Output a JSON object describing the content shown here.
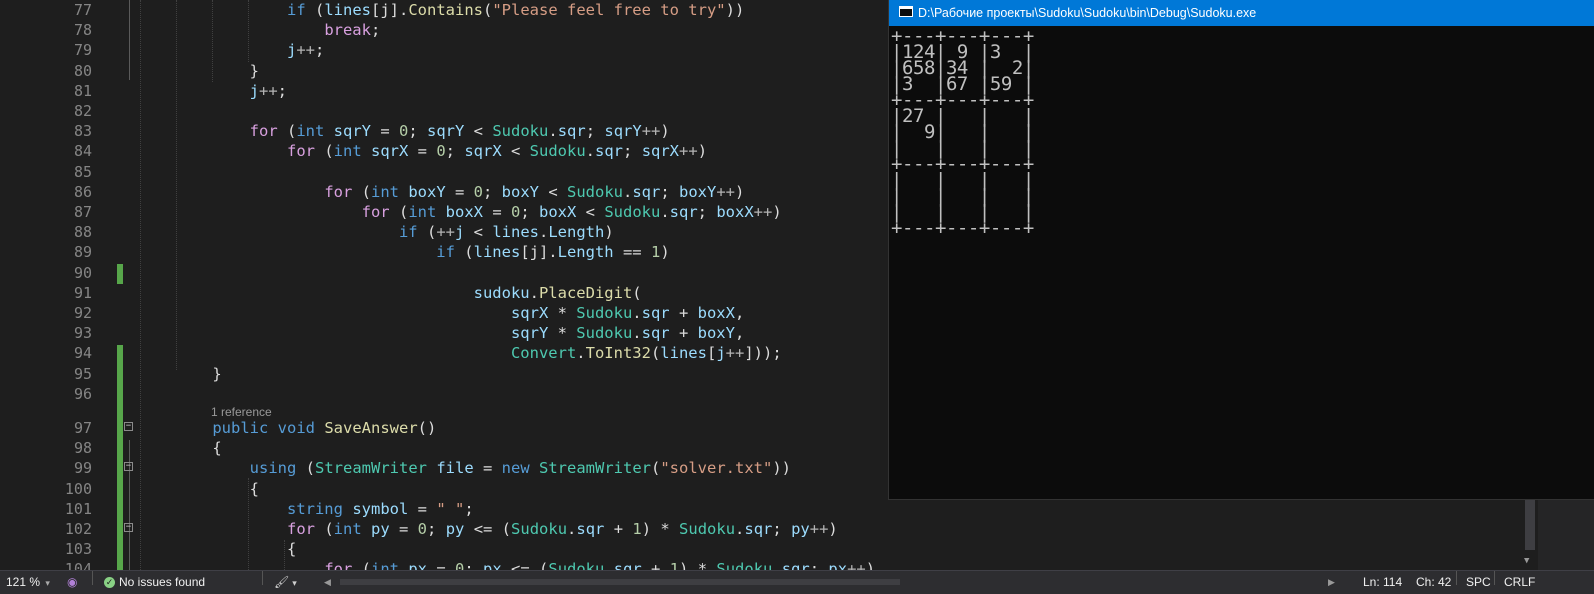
{
  "editor": {
    "reference_hint": "1 reference",
    "lines": [
      {
        "no": "77",
        "tokens": [
          [
            "p",
            "            "
          ],
          [
            "k",
            "if"
          ],
          [
            "p",
            " ("
          ],
          [
            "v",
            "lines"
          ],
          [
            "p",
            "[j]."
          ],
          [
            "m",
            "Contains"
          ],
          [
            "p",
            "("
          ],
          [
            "s",
            "\"Please feel free to try\""
          ],
          [
            "p",
            "))"
          ]
        ]
      },
      {
        "no": "78",
        "tokens": [
          [
            "p",
            "                "
          ],
          [
            "c",
            "break"
          ],
          [
            "p",
            ";"
          ]
        ]
      },
      {
        "no": "79",
        "tokens": [
          [
            "p",
            "            "
          ],
          [
            "v",
            "j"
          ],
          [
            "o",
            "++"
          ],
          [
            "p",
            ";"
          ]
        ]
      },
      {
        "no": "80",
        "tokens": [
          [
            "p",
            "        }"
          ]
        ]
      },
      {
        "no": "81",
        "tokens": [
          [
            "p",
            "        "
          ],
          [
            "v",
            "j"
          ],
          [
            "o",
            "++"
          ],
          [
            "p",
            ";"
          ]
        ]
      },
      {
        "no": "82",
        "tokens": []
      },
      {
        "no": "83",
        "tokens": [
          [
            "p",
            "        "
          ],
          [
            "c",
            "for"
          ],
          [
            "p",
            " ("
          ],
          [
            "k",
            "int"
          ],
          [
            "p",
            " "
          ],
          [
            "v",
            "sqrY"
          ],
          [
            "p",
            " = "
          ],
          [
            "n",
            "0"
          ],
          [
            "p",
            "; "
          ],
          [
            "v",
            "sqrY"
          ],
          [
            "p",
            " < "
          ],
          [
            "t",
            "Sudoku"
          ],
          [
            "p",
            "."
          ],
          [
            "v",
            "sqr"
          ],
          [
            "p",
            "; "
          ],
          [
            "v",
            "sqrY"
          ],
          [
            "o",
            "++"
          ],
          [
            "p",
            ")"
          ]
        ]
      },
      {
        "no": "84",
        "tokens": [
          [
            "p",
            "            "
          ],
          [
            "c",
            "for"
          ],
          [
            "p",
            " ("
          ],
          [
            "k",
            "int"
          ],
          [
            "p",
            " "
          ],
          [
            "v",
            "sqrX"
          ],
          [
            "p",
            " = "
          ],
          [
            "n",
            "0"
          ],
          [
            "p",
            "; "
          ],
          [
            "v",
            "sqrX"
          ],
          [
            "p",
            " < "
          ],
          [
            "t",
            "Sudoku"
          ],
          [
            "p",
            "."
          ],
          [
            "v",
            "sqr"
          ],
          [
            "p",
            "; "
          ],
          [
            "v",
            "sqrX"
          ],
          [
            "o",
            "++"
          ],
          [
            "p",
            ")"
          ]
        ]
      },
      {
        "no": "85",
        "tokens": []
      },
      {
        "no": "86",
        "tokens": [
          [
            "p",
            "                "
          ],
          [
            "c",
            "for"
          ],
          [
            "p",
            " ("
          ],
          [
            "k",
            "int"
          ],
          [
            "p",
            " "
          ],
          [
            "v",
            "boxY"
          ],
          [
            "p",
            " = "
          ],
          [
            "n",
            "0"
          ],
          [
            "p",
            "; "
          ],
          [
            "v",
            "boxY"
          ],
          [
            "p",
            " < "
          ],
          [
            "t",
            "Sudoku"
          ],
          [
            "p",
            "."
          ],
          [
            "v",
            "sqr"
          ],
          [
            "p",
            "; "
          ],
          [
            "v",
            "boxY"
          ],
          [
            "o",
            "++"
          ],
          [
            "p",
            ")"
          ]
        ]
      },
      {
        "no": "87",
        "tokens": [
          [
            "p",
            "                    "
          ],
          [
            "c",
            "for"
          ],
          [
            "p",
            " ("
          ],
          [
            "k",
            "int"
          ],
          [
            "p",
            " "
          ],
          [
            "v",
            "boxX"
          ],
          [
            "p",
            " = "
          ],
          [
            "n",
            "0"
          ],
          [
            "p",
            "; "
          ],
          [
            "v",
            "boxX"
          ],
          [
            "p",
            " < "
          ],
          [
            "t",
            "Sudoku"
          ],
          [
            "p",
            "."
          ],
          [
            "v",
            "sqr"
          ],
          [
            "p",
            "; "
          ],
          [
            "v",
            "boxX"
          ],
          [
            "o",
            "++"
          ],
          [
            "p",
            ")"
          ]
        ]
      },
      {
        "no": "88",
        "tokens": [
          [
            "p",
            "                        "
          ],
          [
            "k",
            "if"
          ],
          [
            "p",
            " ("
          ],
          [
            "o",
            "++"
          ],
          [
            "v",
            "j"
          ],
          [
            "p",
            " < "
          ],
          [
            "v",
            "lines"
          ],
          [
            "p",
            "."
          ],
          [
            "v",
            "Length"
          ],
          [
            "p",
            ")"
          ]
        ]
      },
      {
        "no": "89",
        "tokens": [
          [
            "p",
            "                            "
          ],
          [
            "k",
            "if"
          ],
          [
            "p",
            " ("
          ],
          [
            "v",
            "lines"
          ],
          [
            "p",
            "[j]."
          ],
          [
            "v",
            "Length"
          ],
          [
            "p",
            " == "
          ],
          [
            "n",
            "1"
          ],
          [
            "p",
            ")"
          ]
        ]
      },
      {
        "no": "90",
        "tokens": []
      },
      {
        "no": "91",
        "tokens": [
          [
            "p",
            "                                "
          ],
          [
            "v",
            "sudoku"
          ],
          [
            "p",
            "."
          ],
          [
            "m",
            "PlaceDigit"
          ],
          [
            "p",
            "("
          ]
        ]
      },
      {
        "no": "92",
        "tokens": [
          [
            "p",
            "                                    "
          ],
          [
            "v",
            "sqrX"
          ],
          [
            "p",
            " * "
          ],
          [
            "t",
            "Sudoku"
          ],
          [
            "p",
            "."
          ],
          [
            "v",
            "sqr"
          ],
          [
            "p",
            " + "
          ],
          [
            "v",
            "boxX"
          ],
          [
            "p",
            ","
          ]
        ]
      },
      {
        "no": "93",
        "tokens": [
          [
            "p",
            "                                    "
          ],
          [
            "v",
            "sqrY"
          ],
          [
            "p",
            " * "
          ],
          [
            "t",
            "Sudoku"
          ],
          [
            "p",
            "."
          ],
          [
            "v",
            "sqr"
          ],
          [
            "p",
            " + "
          ],
          [
            "v",
            "boxY"
          ],
          [
            "p",
            ","
          ]
        ]
      },
      {
        "no": "94",
        "tokens": [
          [
            "p",
            "                                    "
          ],
          [
            "t",
            "Convert"
          ],
          [
            "p",
            "."
          ],
          [
            "m",
            "ToInt32"
          ],
          [
            "p",
            "("
          ],
          [
            "v",
            "lines"
          ],
          [
            "p",
            "["
          ],
          [
            "v",
            "j"
          ],
          [
            "o",
            "++"
          ],
          [
            "p",
            "]));"
          ]
        ]
      },
      {
        "no": "95",
        "tokens": [
          [
            "p",
            "    }"
          ]
        ]
      },
      {
        "no": "96",
        "tokens": []
      },
      {
        "no": "97",
        "tokens": [
          [
            "p",
            "    "
          ],
          [
            "k",
            "public"
          ],
          [
            "p",
            " "
          ],
          [
            "k",
            "void"
          ],
          [
            "p",
            " "
          ],
          [
            "m",
            "SaveAnswer"
          ],
          [
            "p",
            "()"
          ]
        ]
      },
      {
        "no": "98",
        "tokens": [
          [
            "p",
            "    {"
          ]
        ]
      },
      {
        "no": "99",
        "tokens": [
          [
            "p",
            "        "
          ],
          [
            "k",
            "using"
          ],
          [
            "p",
            " ("
          ],
          [
            "t",
            "StreamWriter"
          ],
          [
            "p",
            " "
          ],
          [
            "v",
            "file"
          ],
          [
            "p",
            " = "
          ],
          [
            "k",
            "new"
          ],
          [
            "p",
            " "
          ],
          [
            "t",
            "StreamWriter"
          ],
          [
            "p",
            "("
          ],
          [
            "s",
            "\"solver.txt\""
          ],
          [
            "p",
            "))"
          ]
        ]
      },
      {
        "no": "100",
        "tokens": [
          [
            "p",
            "        {"
          ]
        ]
      },
      {
        "no": "101",
        "tokens": [
          [
            "p",
            "            "
          ],
          [
            "k",
            "string"
          ],
          [
            "p",
            " "
          ],
          [
            "v",
            "symbol"
          ],
          [
            "p",
            " = "
          ],
          [
            "s",
            "\" \""
          ],
          [
            "p",
            ";"
          ]
        ]
      },
      {
        "no": "102",
        "tokens": [
          [
            "p",
            "            "
          ],
          [
            "c",
            "for"
          ],
          [
            "p",
            " ("
          ],
          [
            "k",
            "int"
          ],
          [
            "p",
            " "
          ],
          [
            "v",
            "py"
          ],
          [
            "p",
            " = "
          ],
          [
            "n",
            "0"
          ],
          [
            "p",
            "; "
          ],
          [
            "v",
            "py"
          ],
          [
            "p",
            " <= ("
          ],
          [
            "t",
            "Sudoku"
          ],
          [
            "p",
            "."
          ],
          [
            "v",
            "sqr"
          ],
          [
            "p",
            " + "
          ],
          [
            "n",
            "1"
          ],
          [
            "p",
            ") * "
          ],
          [
            "t",
            "Sudoku"
          ],
          [
            "p",
            "."
          ],
          [
            "v",
            "sqr"
          ],
          [
            "p",
            "; "
          ],
          [
            "v",
            "py"
          ],
          [
            "o",
            "++"
          ],
          [
            "p",
            ")"
          ]
        ]
      },
      {
        "no": "103",
        "tokens": [
          [
            "p",
            "            {"
          ]
        ]
      },
      {
        "no": "104",
        "tokens": [
          [
            "p",
            "                "
          ],
          [
            "c",
            "for"
          ],
          [
            "p",
            " ("
          ],
          [
            "k",
            "int"
          ],
          [
            "p",
            " "
          ],
          [
            "v",
            "px"
          ],
          [
            "p",
            " = "
          ],
          [
            "n",
            "0"
          ],
          [
            "p",
            "; "
          ],
          [
            "v",
            "px"
          ],
          [
            "p",
            " <= ("
          ],
          [
            "t",
            "Sudoku"
          ],
          [
            "p",
            "."
          ],
          [
            "v",
            "sqr"
          ],
          [
            "p",
            " + "
          ],
          [
            "n",
            "1"
          ],
          [
            "p",
            ") * "
          ],
          [
            "t",
            "Sudoku"
          ],
          [
            "p",
            "."
          ],
          [
            "v",
            "sqr"
          ],
          [
            "p",
            "; "
          ],
          [
            "v",
            "px"
          ],
          [
            "o",
            "++"
          ],
          [
            "p",
            ")"
          ]
        ]
      }
    ]
  },
  "console": {
    "title": "D:\\Рабочие проекты\\Sudoku\\Sudoku\\bin\\Debug\\Sudoku.exe",
    "output": "+---+---+---+\n|124| 9 |3  |\n|658|34 |  2|\n|3  |67 |59 |\n+---+---+---+\n|27 |   |   |\n|  9|   |   |\n|   |   |   |\n+---+---+---+\n|   |   |   |\n|   |   |   |\n|   |   |   |\n+---+---+---+"
  },
  "statusbar": {
    "zoom": "121 %",
    "issues": "No issues found",
    "line": "Ln: 114",
    "char": "Ch: 42",
    "whitespace": "SPC",
    "line_ending": "CRLF"
  },
  "colors": {
    "editor_bg": "#1e1e1e",
    "keyword": "#569cd6",
    "control": "#d8a0df",
    "type": "#4ec9b0",
    "method": "#dcdcaa",
    "variable": "#9cdcfe",
    "string": "#d69d85",
    "number": "#b5cea8",
    "change_bar": "#57a64a",
    "console_title": "#0078d7",
    "status_ok": "#89d185"
  }
}
